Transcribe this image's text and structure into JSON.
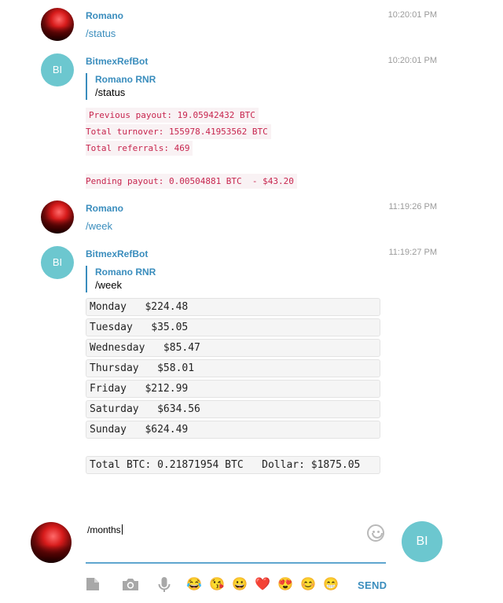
{
  "messages": [
    {
      "sender": "Romano",
      "time": "10:20:01 PM",
      "text": "/status"
    },
    {
      "sender": "BitmexRefBot",
      "initials": "BI",
      "time": "10:20:01 PM",
      "reply": {
        "name": "Romano RNR",
        "text": "/status"
      },
      "lines": [
        "Previous payout: 19.05942432 BTC",
        "Total turnover: 155978.41953562 BTC",
        "Total referrals: 469",
        "Pending payout: 0.00504881 BTC  - $43.20"
      ]
    },
    {
      "sender": "Romano",
      "time": "11:19:26 PM",
      "text": "/week"
    },
    {
      "sender": "BitmexRefBot",
      "initials": "BI",
      "time": "11:19:27 PM",
      "reply": {
        "name": "Romano RNR",
        "text": "/week"
      },
      "rows": [
        "Monday   $224.48",
        "Tuesday   $35.05",
        "Wednesday   $85.47",
        "Thursday   $58.01",
        "Friday   $212.99",
        "Saturday   $634.56",
        "Sunday   $624.49"
      ],
      "total": "Total BTC: 0.21871954 BTC   Dollar: $1875.05"
    }
  ],
  "composer": {
    "value": "/months",
    "send_label": "SEND",
    "bot_initials": "BI"
  },
  "toolbar": {
    "icons": [
      "file-icon",
      "camera-icon",
      "microphone-icon"
    ],
    "emojis": [
      "😂",
      "😘",
      "😀",
      "❤️",
      "😍",
      "😊",
      "😁"
    ]
  },
  "colors": {
    "accent": "#3a8dbd",
    "bot_avatar": "#6cc7cf",
    "code_text": "#c7254e",
    "code_bg": "#f9f2f4"
  }
}
